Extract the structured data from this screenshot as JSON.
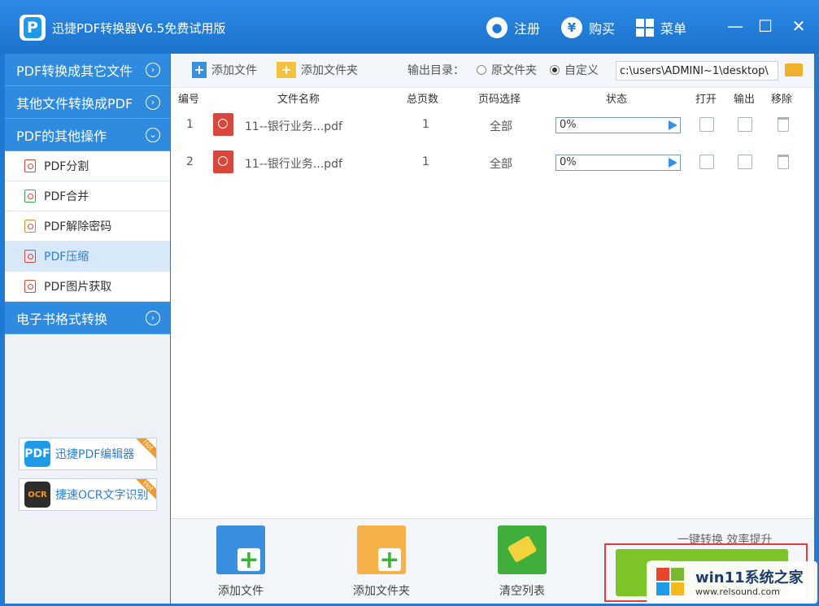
{
  "titlebar": {
    "title": "迅捷PDF转换器V6.5免费试用版",
    "register": "注册",
    "buy": "购买",
    "menu": "菜单",
    "register_icon": "user-icon",
    "buy_icon": "yen-icon",
    "menu_icon": "grid-icon",
    "minimize": "—",
    "maximize": "☐",
    "close": "✕"
  },
  "sidebar": {
    "groups": [
      {
        "label": "PDF转换成其它文件"
      },
      {
        "label": "其他文件转换成PDF"
      },
      {
        "label": "PDF的其他操作"
      },
      {
        "label": "电子书格式转换"
      }
    ],
    "subitems": [
      {
        "label": "PDF分割"
      },
      {
        "label": "PDF合并"
      },
      {
        "label": "PDF解除密码"
      },
      {
        "label": "PDF压缩"
      },
      {
        "label": "PDF图片获取"
      }
    ],
    "active_subitem": "PDF压缩",
    "promos": [
      {
        "label": "迅捷PDF编辑器",
        "logo": "PDF",
        "badge": "Hot"
      },
      {
        "label": "捷速OCR文字识别",
        "logo": "OCR",
        "badge": "Hot"
      }
    ]
  },
  "toolbar": {
    "add_file": "添加文件",
    "add_folder": "添加文件夹",
    "output_dir_label": "输出目录：",
    "radio_original": "原文件夹",
    "radio_custom": "自定义",
    "selected_radio": "自定义",
    "output_path": "c:\\users\\ADMINI~1\\desktop\\"
  },
  "table": {
    "headers": [
      "编号",
      "文件名称",
      "总页数",
      "页码选择",
      "状态",
      "打开",
      "输出",
      "移除"
    ],
    "rows": [
      {
        "num": "1",
        "name": "11--银行业务...pdf",
        "pages": "1",
        "range": "全部",
        "status": "0%",
        "progress": 0
      },
      {
        "num": "2",
        "name": "11--银行业务...pdf",
        "pages": "1",
        "range": "全部",
        "status": "0%",
        "progress": 0
      }
    ]
  },
  "bottom": {
    "add_file": "添加文件",
    "add_folder": "添加文件夹",
    "clear_list": "清空列表",
    "tagline": "一键转换  效率提升"
  },
  "watermark": {
    "title": "win11系统之家",
    "url": "www.relsound.com"
  },
  "colors": {
    "titlebar": "#1f7ad6",
    "sidebar_group": "#2e8be0",
    "active_item": "#d7e9f9",
    "start_button": "#7cc427",
    "highlight_frame": "#e63b36"
  }
}
